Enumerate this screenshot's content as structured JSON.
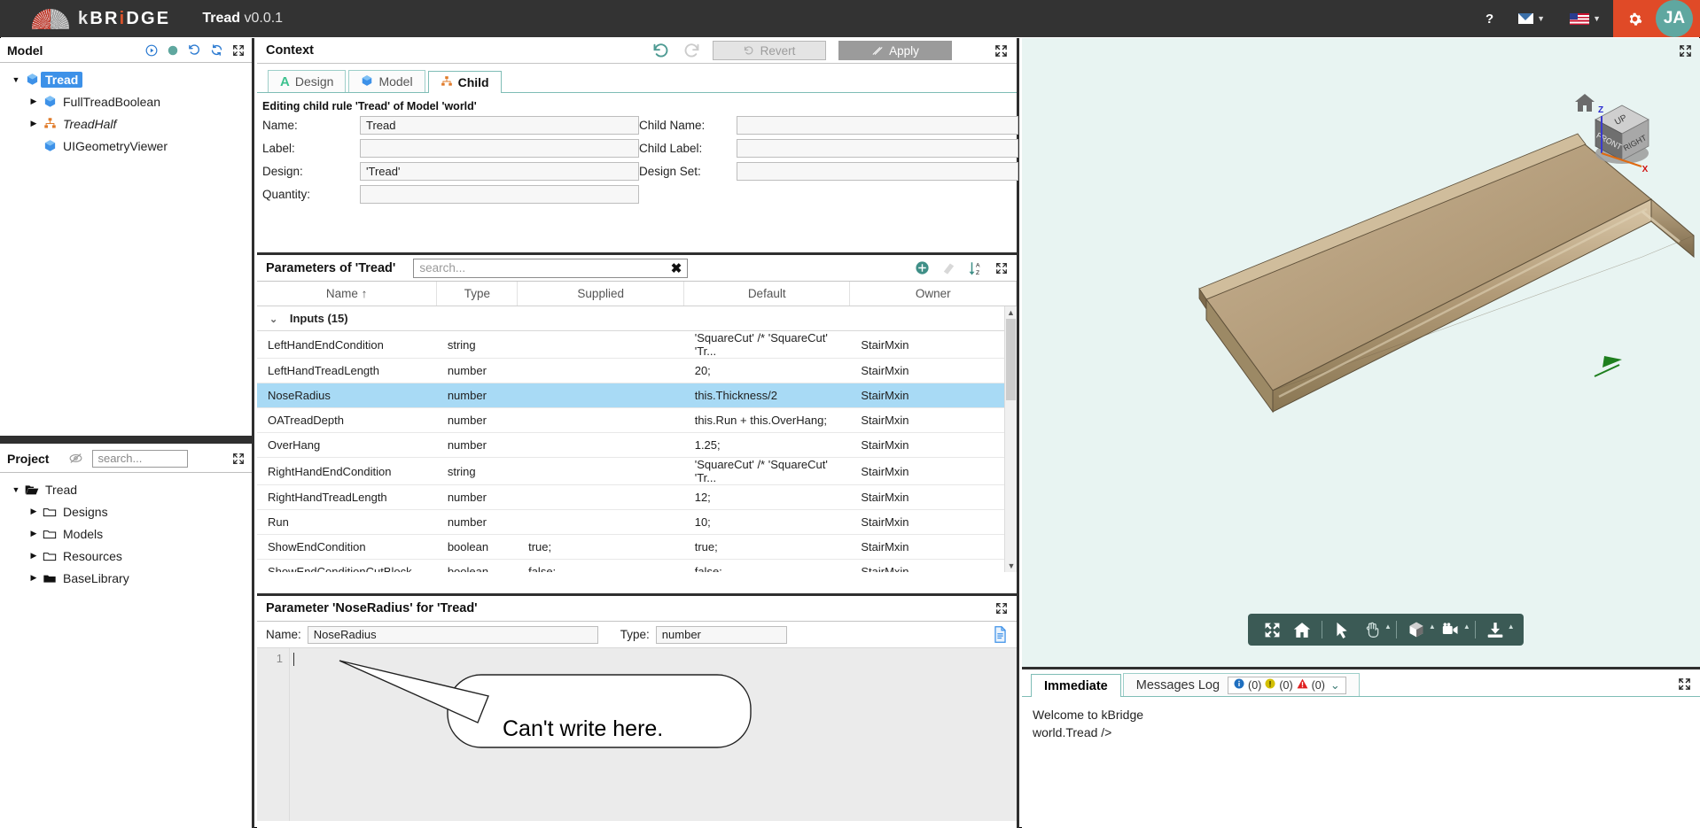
{
  "header": {
    "brand_k": "k",
    "brand_rest": "BR",
    "brand_i": "i",
    "brand_tail": "DGE",
    "doc_title": "Tread",
    "doc_version": "v0.0.1",
    "help_label": "?",
    "avatar_initials": "JA",
    "icons": {
      "help": "question-mark-icon",
      "mail": "envelope-icon",
      "language": "us-flag-icon",
      "settings": "gear-icon"
    }
  },
  "model_panel": {
    "title": "Model",
    "tools": [
      "run-icon",
      "status-dot-icon",
      "history-icon",
      "refresh-icon",
      "expand-icon"
    ],
    "tree": [
      {
        "label": "Tread",
        "icon": "cube-icon",
        "caret": "▼",
        "selected": true,
        "indent": 0,
        "italic": false
      },
      {
        "label": "FullTreadBoolean",
        "icon": "cube-icon",
        "caret": "▶",
        "selected": false,
        "indent": 1,
        "italic": false
      },
      {
        "label": "TreadHalf",
        "icon": "hierarchy-icon",
        "caret": "▶",
        "selected": false,
        "indent": 1,
        "italic": true
      },
      {
        "label": "UIGeometryViewer",
        "icon": "cube-icon",
        "caret": "",
        "selected": false,
        "indent": 1,
        "italic": false
      }
    ]
  },
  "project_panel": {
    "title": "Project",
    "visibility_icon": "eye-slash-icon",
    "search_placeholder": "search...",
    "expand_icon": "expand-icon",
    "tree": [
      {
        "label": "Tread",
        "icon": "folder-open-icon",
        "caret": "▼",
        "indent": 0
      },
      {
        "label": "Designs",
        "icon": "folder-icon",
        "caret": "▶",
        "indent": 1
      },
      {
        "label": "Models",
        "icon": "folder-icon",
        "caret": "▶",
        "indent": 1
      },
      {
        "label": "Resources",
        "icon": "folder-icon",
        "caret": "▶",
        "indent": 1
      },
      {
        "label": "BaseLibrary",
        "icon": "folder-filled-icon",
        "caret": "▶",
        "indent": 1
      }
    ]
  },
  "context": {
    "title": "Context",
    "undo_icon": "undo-icon",
    "redo_icon": "redo-icon",
    "revert_label": "Revert",
    "apply_label": "Apply",
    "expand_icon": "expand-icon",
    "tabs": [
      {
        "label": "Design",
        "icon": "design-a-icon",
        "active": false
      },
      {
        "label": "Model",
        "icon": "cube-icon",
        "active": false
      },
      {
        "label": "Child",
        "icon": "hierarchy-icon",
        "active": true
      }
    ],
    "note": "Editing child rule 'Tread' of Model 'world'",
    "fields": [
      {
        "label": "Name:",
        "value": "Tread"
      },
      {
        "label": "Child Name:",
        "value": ""
      },
      {
        "label": "Label:",
        "value": ""
      },
      {
        "label": "Child Label:",
        "value": ""
      },
      {
        "label": "Design:",
        "value": "'Tread'"
      },
      {
        "label": "Design Set:",
        "value": ""
      },
      {
        "label": "Quantity:",
        "value": ""
      }
    ]
  },
  "parameters": {
    "title": "Parameters of 'Tread'",
    "search_placeholder": "search...",
    "search_clear": "✖",
    "tools": [
      "add-icon",
      "erase-icon",
      "sort-az-icon",
      "expand-icon"
    ],
    "columns": [
      "Name  ↑",
      "Type",
      "Supplied",
      "Default",
      "Owner"
    ],
    "group": {
      "label": "Inputs (15)",
      "caret": "⌄"
    },
    "rows": [
      {
        "name": "LeftHandEndCondition",
        "type": "string",
        "supplied": "",
        "default": "'SquareCut' /* 'SquareCut' 'Tr...",
        "owner": "StairMxin",
        "selected": false
      },
      {
        "name": "LeftHandTreadLength",
        "type": "number",
        "supplied": "",
        "default": "20;",
        "owner": "StairMxin",
        "selected": false
      },
      {
        "name": "NoseRadius",
        "type": "number",
        "supplied": "",
        "default": "this.Thickness/2",
        "owner": "StairMxin",
        "selected": true
      },
      {
        "name": "OATreadDepth",
        "type": "number",
        "supplied": "",
        "default": "this.Run + this.OverHang;",
        "owner": "StairMxin",
        "selected": false
      },
      {
        "name": "OverHang",
        "type": "number",
        "supplied": "",
        "default": "1.25;",
        "owner": "StairMxin",
        "selected": false
      },
      {
        "name": "RightHandEndCondition",
        "type": "string",
        "supplied": "",
        "default": "'SquareCut' /* 'SquareCut' 'Tr...",
        "owner": "StairMxin",
        "selected": false
      },
      {
        "name": "RightHandTreadLength",
        "type": "number",
        "supplied": "",
        "default": "12;",
        "owner": "StairMxin",
        "selected": false
      },
      {
        "name": "Run",
        "type": "number",
        "supplied": "",
        "default": "10;",
        "owner": "StairMxin",
        "selected": false
      },
      {
        "name": "ShowEndCondition",
        "type": "boolean",
        "supplied": "true;",
        "default": "true;",
        "owner": "StairMxin",
        "selected": false
      },
      {
        "name": "ShowEndConditionCutBlock",
        "type": "boolean",
        "supplied": "false;",
        "default": "false;",
        "owner": "StairMxin",
        "selected": false
      }
    ]
  },
  "param_editor": {
    "title": "Parameter 'NoseRadius' for 'Tread'",
    "expand_icon": "expand-icon",
    "name_label": "Name:",
    "name_value": "NoseRadius",
    "type_label": "Type:",
    "type_value": "number",
    "doc_icon": "document-icon",
    "line_number": "1",
    "code_value": "",
    "callout_text": "Can't write here."
  },
  "viewport": {
    "expand_icon": "expand-icon",
    "home_icon": "home-icon",
    "viewcube": {
      "top": "UP",
      "left": "FRONT",
      "right": "RIGHT",
      "axis_x": "X",
      "axis_z": "Z"
    },
    "toolbar": [
      {
        "icon": "fit-view-icon",
        "caret": false
      },
      {
        "icon": "home-icon",
        "caret": false
      },
      {
        "icon": "separator",
        "caret": false
      },
      {
        "icon": "cursor-select-icon",
        "caret": false
      },
      {
        "icon": "pan-hand-icon",
        "caret": true
      },
      {
        "icon": "separator",
        "caret": false
      },
      {
        "icon": "cube-shading-icon",
        "caret": true
      },
      {
        "icon": "camera-icon",
        "caret": true
      },
      {
        "icon": "separator",
        "caret": false
      },
      {
        "icon": "download-icon",
        "caret": true
      }
    ],
    "colors": {
      "background": "#e8f4f2",
      "model_top": "#b7a183",
      "model_side": "#8d7a5e"
    }
  },
  "console": {
    "tabs": [
      {
        "label": "Immediate",
        "active": true
      },
      {
        "label": "Messages Log",
        "active": false
      }
    ],
    "badges": [
      {
        "icon": "info-icon",
        "count": "(0)",
        "color": "#1f6fbf"
      },
      {
        "icon": "warning-dot-icon",
        "count": "(0)",
        "color": "#d4c004"
      },
      {
        "icon": "error-triangle-icon",
        "count": "(0)",
        "color": "#e02020"
      }
    ],
    "badge_caret": "⌄",
    "expand_icon": "expand-icon",
    "lines": [
      "Welcome to kBridge",
      "world.Tread />"
    ]
  }
}
